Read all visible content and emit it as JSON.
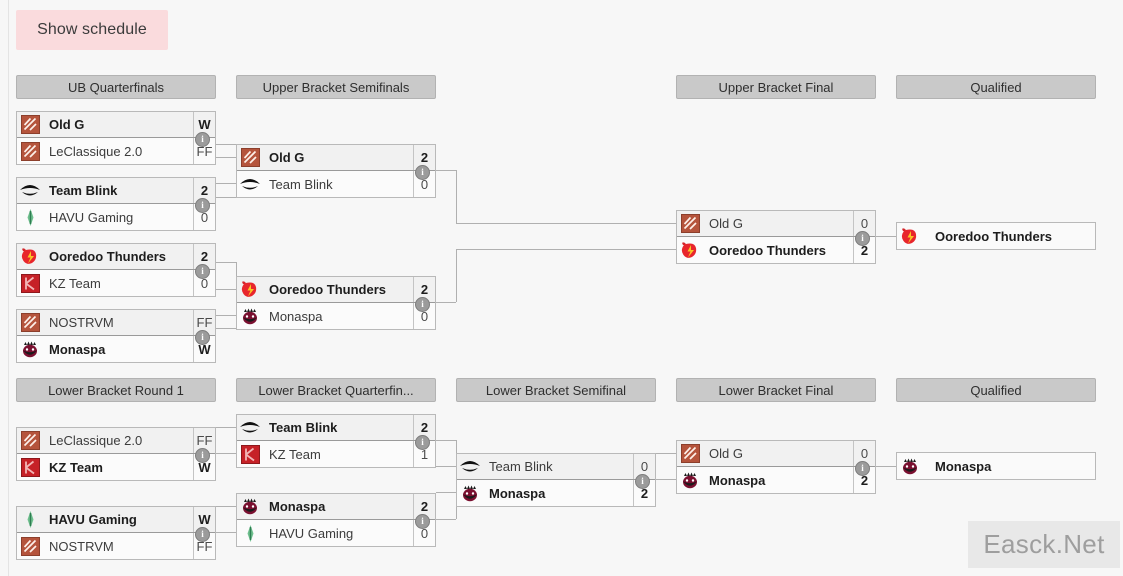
{
  "toolbar": {
    "show_schedule_label": "Show schedule"
  },
  "watermark": {
    "text": "Easck.Net"
  },
  "info_glyph": "i",
  "rounds": {
    "ub_quarterfinals": "UB Quarterfinals",
    "ub_semifinals": "Upper Bracket Semifinals",
    "ub_final": "Upper Bracket Final",
    "ub_qualified": "Qualified",
    "lb_round1": "Lower Bracket Round 1",
    "lb_quarterfinals": "Lower Bracket Quarterfin...",
    "lb_semifinal": "Lower Bracket Semifinal",
    "lb_final": "Lower Bracket Final",
    "lb_qualified": "Qualified"
  },
  "matches": {
    "ubqf1": {
      "top": {
        "team": "Old G",
        "score": "W",
        "logo": "dota-default",
        "winner": true
      },
      "bottom": {
        "team": "LeClassique 2.0",
        "score": "FF",
        "logo": "dota-default",
        "winner": false
      }
    },
    "ubqf2": {
      "top": {
        "team": "Team Blink",
        "score": "2",
        "logo": "team-blink",
        "winner": true
      },
      "bottom": {
        "team": "HAVU Gaming",
        "score": "0",
        "logo": "havu",
        "winner": false
      }
    },
    "ubqf3": {
      "top": {
        "team": "Ooredoo Thunders",
        "score": "2",
        "logo": "ooredoo",
        "winner": true
      },
      "bottom": {
        "team": "KZ Team",
        "score": "0",
        "logo": "kz",
        "winner": false
      }
    },
    "ubqf4": {
      "top": {
        "team": "NOSTRVM",
        "score": "FF",
        "logo": "dota-default",
        "winner": false
      },
      "bottom": {
        "team": "Monaspa",
        "score": "W",
        "logo": "monaspa",
        "winner": true
      }
    },
    "ubsf1": {
      "top": {
        "team": "Old G",
        "score": "2",
        "logo": "dota-default",
        "winner": true
      },
      "bottom": {
        "team": "Team Blink",
        "score": "0",
        "logo": "team-blink",
        "winner": false
      }
    },
    "ubsf2": {
      "top": {
        "team": "Ooredoo Thunders",
        "score": "2",
        "logo": "ooredoo",
        "winner": true
      },
      "bottom": {
        "team": "Monaspa",
        "score": "0",
        "logo": "monaspa",
        "winner": false
      }
    },
    "ubf": {
      "top": {
        "team": "Old G",
        "score": "0",
        "logo": "dota-default",
        "winner": false
      },
      "bottom": {
        "team": "Ooredoo Thunders",
        "score": "2",
        "logo": "ooredoo",
        "winner": true
      }
    },
    "lbr1_1": {
      "top": {
        "team": "LeClassique 2.0",
        "score": "FF",
        "logo": "dota-default",
        "winner": false
      },
      "bottom": {
        "team": "KZ Team",
        "score": "W",
        "logo": "kz",
        "winner": true
      }
    },
    "lbr1_2": {
      "top": {
        "team": "HAVU Gaming",
        "score": "W",
        "logo": "havu",
        "winner": true
      },
      "bottom": {
        "team": "NOSTRVM",
        "score": "FF",
        "logo": "dota-default",
        "winner": false
      }
    },
    "lbqf1": {
      "top": {
        "team": "Team Blink",
        "score": "2",
        "logo": "team-blink",
        "winner": true
      },
      "bottom": {
        "team": "KZ Team",
        "score": "1",
        "logo": "kz",
        "winner": false
      }
    },
    "lbqf2": {
      "top": {
        "team": "Monaspa",
        "score": "2",
        "logo": "monaspa",
        "winner": true
      },
      "bottom": {
        "team": "HAVU Gaming",
        "score": "0",
        "logo": "havu",
        "winner": false
      }
    },
    "lbsf": {
      "top": {
        "team": "Team Blink",
        "score": "0",
        "logo": "team-blink",
        "winner": false
      },
      "bottom": {
        "team": "Monaspa",
        "score": "2",
        "logo": "monaspa",
        "winner": true
      }
    },
    "lbf": {
      "top": {
        "team": "Old G",
        "score": "0",
        "logo": "dota-default",
        "winner": false
      },
      "bottom": {
        "team": "Monaspa",
        "score": "2",
        "logo": "monaspa",
        "winner": true
      }
    }
  },
  "qualified": {
    "upper": {
      "team": "Ooredoo Thunders",
      "logo": "ooredoo"
    },
    "lower": {
      "team": "Monaspa",
      "logo": "monaspa"
    }
  },
  "colors": {
    "background": "#f7f7f7",
    "header_bar": "#c9c9c9",
    "button_pink": "#fadbdd",
    "connector": "#b0b0b0",
    "box_border": "#b9b9b9"
  }
}
